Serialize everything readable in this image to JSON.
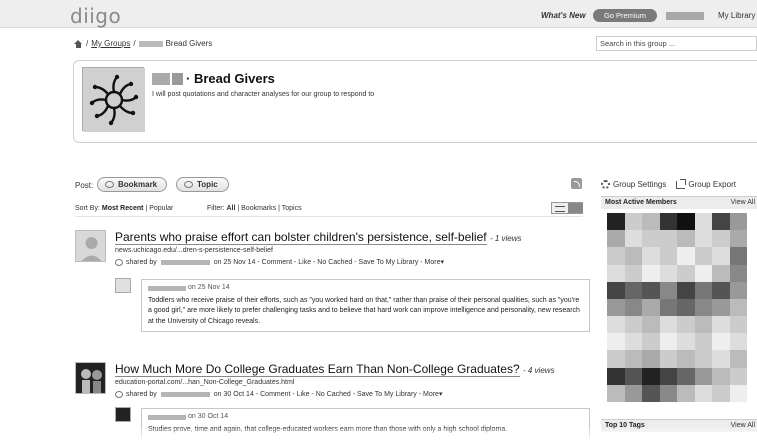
{
  "topbar": {
    "logo": "diigo",
    "whats_new": "What's New",
    "go_premium": "Go Premium",
    "my_library": "My Library"
  },
  "breadcrumb": {
    "my_groups": "My Groups",
    "group_name": "Bread Givers"
  },
  "search": {
    "placeholder": "Search in this group ..."
  },
  "group": {
    "title": "· Bread Givers",
    "description": "I will post quotations and character analyses for our group to respond to"
  },
  "post": {
    "label": "Post:",
    "bookmark": "Bookmark",
    "topic": "Topic"
  },
  "sort": {
    "label": "Sort By:",
    "most_recent": "Most Recent",
    "popular": "Popular"
  },
  "filter": {
    "label": "Filter:",
    "all": "All",
    "bookmarks": "Bookmarks",
    "topics": "Topics"
  },
  "bookmarks": [
    {
      "title": "Parents who praise effort can bolster children's persistence, self-belief",
      "views": "- 1 views",
      "url": "news.uchicago.edu/...dren-s-persistence-self-belief",
      "shared_by": "shared by",
      "date": "on 25 Nov 14",
      "actions": "- Comment - Like - No Cached - Save To My Library - More▾",
      "comment_date": "on 25 Nov 14",
      "comment_text": "Toddlers who receive praise of their efforts, such as \"you worked hard on that,\" rather than praise of their personal qualities, such as \"you're a good girl,\" are more likely to prefer challenging tasks and to believe that hard work can improve intelligence and personality, new research at the University of Chicago reveals."
    },
    {
      "title": "How Much More Do College Graduates Earn Than Non-College Graduates?",
      "views": "- 4 views",
      "url": "education-portal.com/...han_Non-College_Graduates.html",
      "shared_by": "shared by",
      "date": "on 30 Oct 14",
      "actions": "- Comment - Like - No Cached - Save To My Library - More▾",
      "comment_date": "on 30 Oct 14",
      "comment_text": "Studies prove, time and again, that college-educated workers earn more than those with only a high school diploma."
    }
  ],
  "sidebar": {
    "group_settings": "Group Settings",
    "group_export": "Group Export",
    "most_active": "Most Active Members",
    "view_all": "View All",
    "top_tags": "Top 10 Tags",
    "view_all_tags": "View All"
  }
}
